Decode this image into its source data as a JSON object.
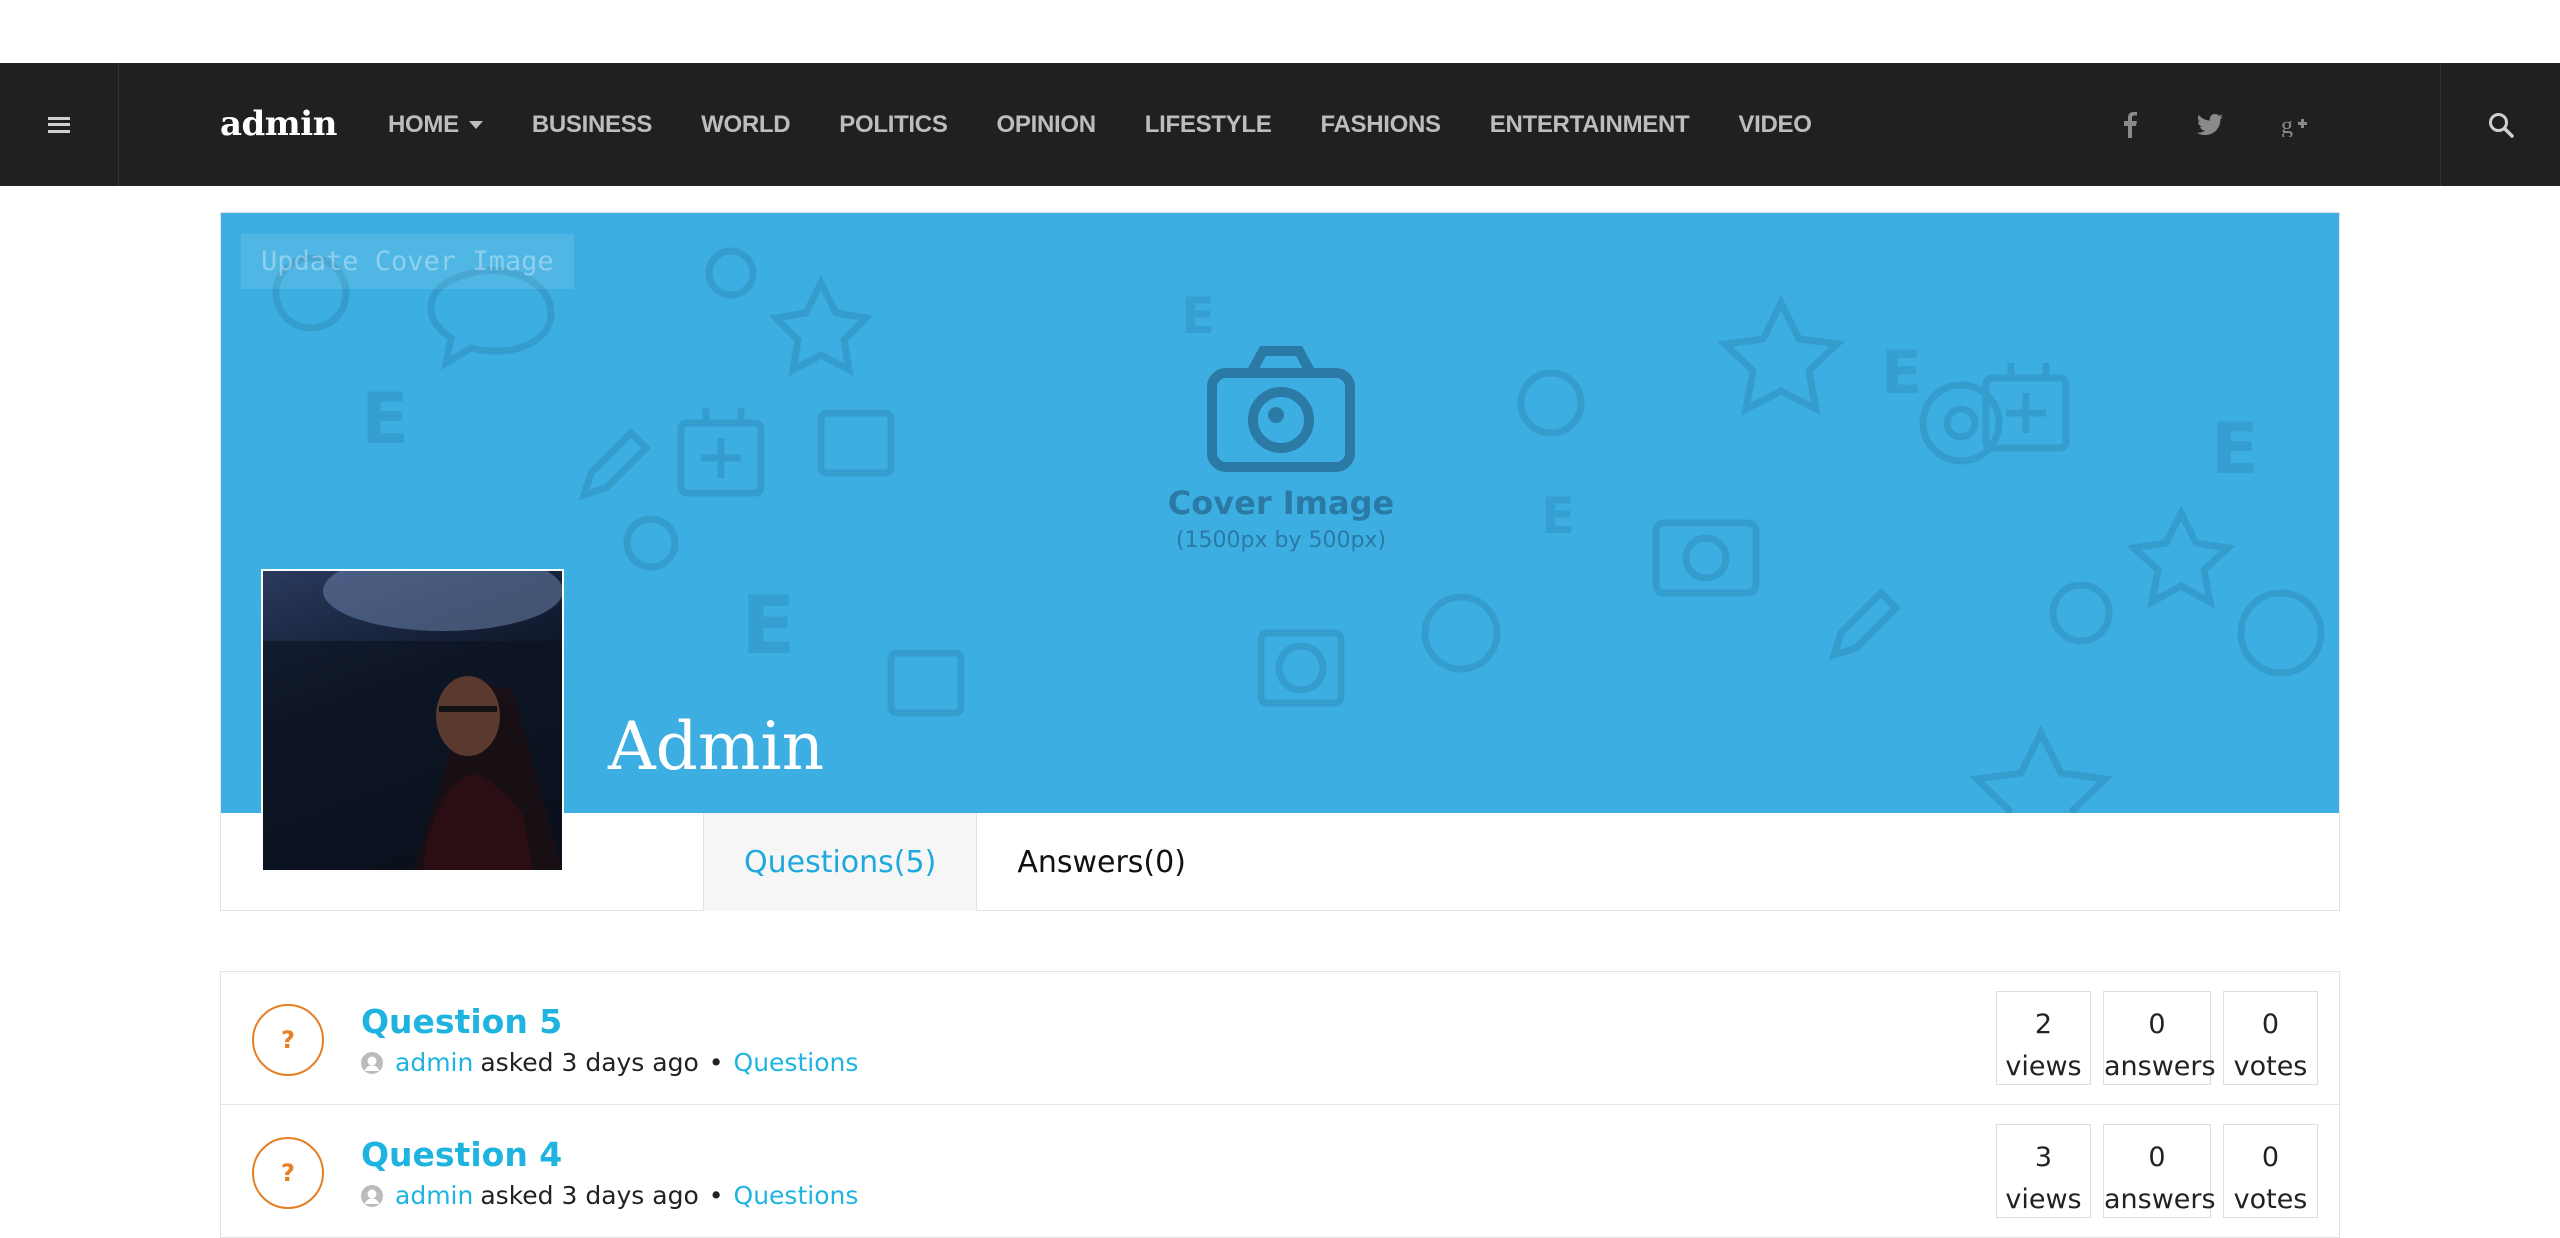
{
  "header": {
    "logo": "admin",
    "nav": [
      {
        "label": "HOME",
        "has_dropdown": true
      },
      {
        "label": "BUSINESS"
      },
      {
        "label": "WORLD"
      },
      {
        "label": "POLITICS"
      },
      {
        "label": "OPINION"
      },
      {
        "label": "LIFESTYLE"
      },
      {
        "label": "FASHIONS"
      },
      {
        "label": "ENTERTAINMENT"
      },
      {
        "label": "VIDEO"
      }
    ],
    "social": [
      "facebook-icon",
      "twitter-icon",
      "google-plus-icon"
    ]
  },
  "profile": {
    "update_cover_label": "Update Cover Image",
    "cover_placeholder_title": "Cover Image",
    "cover_placeholder_dims": "(1500px by 500px)",
    "name": "Admin",
    "tabs": [
      {
        "label": "Questions(5)",
        "active": true
      },
      {
        "label": "Answers(0)",
        "active": false
      }
    ]
  },
  "questions": [
    {
      "badge": "?",
      "title": "Question 5",
      "author": "admin",
      "asked": "asked 3 days ago",
      "separator": "•",
      "category": "Questions",
      "views": "2",
      "views_label": "views",
      "answers": "0",
      "answers_label": "answers",
      "votes": "0",
      "votes_label": "votes"
    },
    {
      "badge": "?",
      "title": "Question 4",
      "author": "admin",
      "asked": "asked 3 days ago",
      "separator": "•",
      "category": "Questions",
      "views": "3",
      "views_label": "views",
      "answers": "0",
      "answers_label": "answers",
      "votes": "0",
      "votes_label": "votes"
    }
  ],
  "colors": {
    "accent": "#1fb4e0",
    "cover": "#3daee1",
    "badge": "#e67e22",
    "topbar": "#202020"
  }
}
